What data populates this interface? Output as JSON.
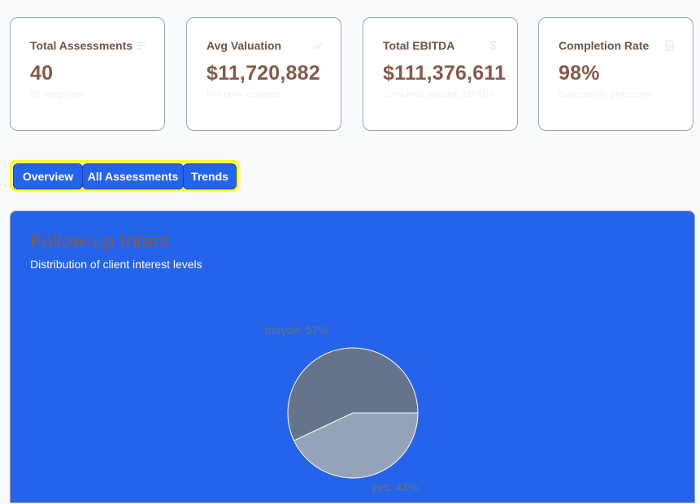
{
  "stats": [
    {
      "title": "Total Assessments",
      "value": "40",
      "sub": "39 completed",
      "icon": "file-list-icon"
    },
    {
      "title": "Avg Valuation",
      "value": "$11,720,882",
      "sub": "Mid-point estimate",
      "icon": "trend-icon"
    },
    {
      "title": "Total EBITDA",
      "value": "$111,376,611",
      "sub": "Combined adjusted EBITDA",
      "icon": "dollar-icon"
    },
    {
      "title": "Completion Rate",
      "value": "98%",
      "sub": "Successfully processed",
      "icon": "document-icon"
    }
  ],
  "tabs": [
    "Overview",
    "All Assessments",
    "Trends"
  ],
  "panel": {
    "title": "Follow-up Intent",
    "description": "Distribution of client interest levels"
  },
  "colors": {
    "maybe": "#64748b",
    "yes": "#94a3b8",
    "panel_bg": "#2563eb"
  },
  "chart_data": {
    "type": "pie",
    "slices": [
      {
        "name": "maybe",
        "percent": 57,
        "label": "maybe: 57%"
      },
      {
        "name": "yes",
        "percent": 43,
        "label": "yes: 43%"
      }
    ]
  }
}
